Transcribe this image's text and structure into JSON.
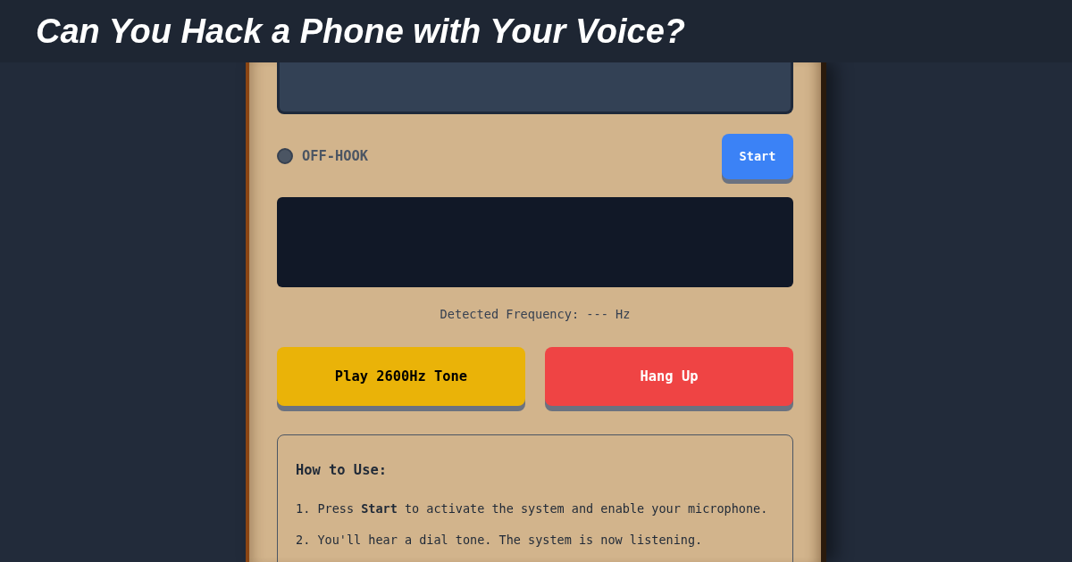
{
  "title": "Can You Hack a Phone with Your Voice?",
  "phone": {
    "status": {
      "on": false,
      "label": "OFF-HOOK"
    },
    "start_button": "Start",
    "frequency_readout": "Detected Frequency: --- Hz",
    "actions": [
      {
        "label": "Play 2600Hz Tone",
        "kind": "tone"
      },
      {
        "label": "Hang Up",
        "kind": "hangup"
      }
    ],
    "instructions": {
      "heading": "How to Use:",
      "steps": [
        "1. Press **Start** to activate the system and enable your microphone.",
        "2. You'll hear a dial tone. The system is now listening."
      ]
    }
  }
}
